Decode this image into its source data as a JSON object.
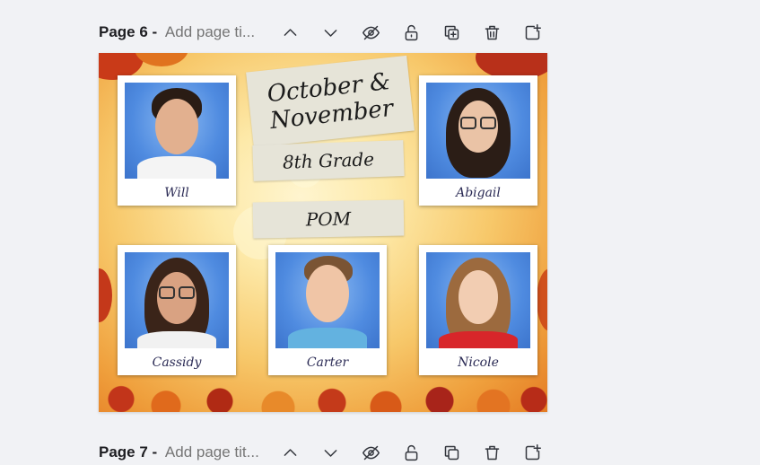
{
  "pages": [
    {
      "label": "Page 6 - ",
      "title_placeholder": "Add page title",
      "title_shown": "Add page ti..."
    },
    {
      "label": "Page 7 - ",
      "title_placeholder": "Add page title",
      "title_shown": "Add page tit..."
    }
  ],
  "tools": [
    "chevron-up-icon",
    "chevron-down-icon",
    "hide-eye-icon",
    "unlock-icon",
    "duplicate-page-icon",
    "delete-icon",
    "add-page-icon"
  ],
  "design": {
    "heading_line1": "October &",
    "heading_line2": "November",
    "grade": "8th Grade",
    "subtitle": "POM",
    "students": [
      {
        "name": "Will"
      },
      {
        "name": "Abigail"
      },
      {
        "name": "Cassidy"
      },
      {
        "name": "Carter"
      },
      {
        "name": "Nicole"
      }
    ]
  },
  "colors": {
    "background": "#f1f2f5",
    "label_text": "#1e1e22",
    "placeholder_text": "#7a7d86",
    "icon_stroke": "#33363d"
  }
}
